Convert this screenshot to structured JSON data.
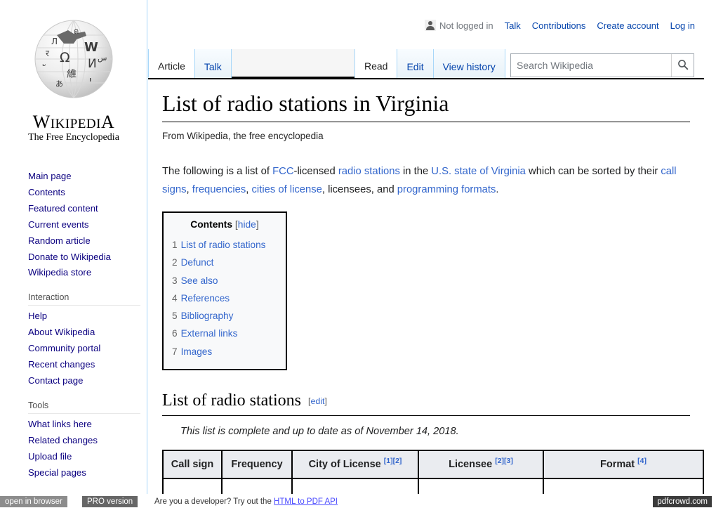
{
  "branding": {
    "wordmark_w": "W",
    "wordmark_rest": "IKIPEDI",
    "wordmark_a": "A",
    "tagline": "The Free Encyclopedia",
    "logo_alt": "wikipedia-globe-logo"
  },
  "user_bar": {
    "user_icon": "user-silhouette-icon",
    "not_logged_in": "Not logged in",
    "links": [
      {
        "label": "Talk"
      },
      {
        "label": "Contributions"
      },
      {
        "label": "Create account"
      },
      {
        "label": "Log in"
      }
    ]
  },
  "tabs": {
    "namespaces": [
      {
        "label": "Article",
        "selected": true
      },
      {
        "label": "Talk",
        "selected": false
      }
    ],
    "views": [
      {
        "label": "Read",
        "selected": true
      },
      {
        "label": "Edit",
        "selected": false
      },
      {
        "label": "View history",
        "selected": false
      }
    ]
  },
  "search": {
    "placeholder": "Search Wikipedia",
    "value": "",
    "icon": "search-icon"
  },
  "sidebar": {
    "portals": [
      {
        "heading": "",
        "items": [
          {
            "label": "Main page"
          },
          {
            "label": "Contents"
          },
          {
            "label": "Featured content"
          },
          {
            "label": "Current events"
          },
          {
            "label": "Random article"
          },
          {
            "label": "Donate to Wikipedia"
          },
          {
            "label": "Wikipedia store"
          }
        ]
      },
      {
        "heading": "Interaction",
        "items": [
          {
            "label": "Help"
          },
          {
            "label": "About Wikipedia"
          },
          {
            "label": "Community portal"
          },
          {
            "label": "Recent changes"
          },
          {
            "label": "Contact page"
          }
        ]
      },
      {
        "heading": "Tools",
        "items": [
          {
            "label": "What links here"
          },
          {
            "label": "Related changes"
          },
          {
            "label": "Upload file"
          },
          {
            "label": "Special pages"
          }
        ]
      }
    ]
  },
  "article": {
    "title": "List of radio stations in Virginia",
    "site_sub": "From Wikipedia, the free encyclopedia",
    "intro": [
      {
        "t": "The following is a list of ",
        "link": false
      },
      {
        "t": "FCC",
        "link": true
      },
      {
        "t": "-licensed ",
        "link": false
      },
      {
        "t": "radio stations",
        "link": true
      },
      {
        "t": " in the ",
        "link": false
      },
      {
        "t": "U.S. state of Virginia",
        "link": true
      },
      {
        "t": " which can be sorted by their ",
        "link": false
      },
      {
        "t": "call signs",
        "link": true
      },
      {
        "t": ", ",
        "link": false
      },
      {
        "t": "frequencies",
        "link": true
      },
      {
        "t": ", ",
        "link": false
      },
      {
        "t": "cities of license",
        "link": true
      },
      {
        "t": ", licensees, and ",
        "link": false
      },
      {
        "t": "programming formats",
        "link": true
      },
      {
        "t": ".",
        "link": false
      }
    ]
  },
  "toc": {
    "title": "Contents",
    "bracket_open": "[",
    "hide_label": "hide",
    "bracket_close": "]",
    "items": [
      {
        "num": "1",
        "label": "List of radio stations"
      },
      {
        "num": "2",
        "label": "Defunct"
      },
      {
        "num": "3",
        "label": "See also"
      },
      {
        "num": "4",
        "label": "References"
      },
      {
        "num": "5",
        "label": "Bibliography"
      },
      {
        "num": "6",
        "label": "External links"
      },
      {
        "num": "7",
        "label": "Images"
      }
    ]
  },
  "section": {
    "heading": "List of radio stations",
    "edit_open": "[",
    "edit_label": "edit",
    "edit_close": "]",
    "note": "This list is complete and up to date as of November 14, 2018."
  },
  "table": {
    "headers": [
      {
        "label": "Call sign",
        "refs": ""
      },
      {
        "label": "Frequency",
        "refs": ""
      },
      {
        "label": "City of License",
        "refs": "[1][2]"
      },
      {
        "label": "Licensee",
        "refs": "[2][3]"
      },
      {
        "label": "Format",
        "refs": "[4]"
      }
    ]
  },
  "footer_bar": {
    "open_in_browser": "open in browser",
    "pro_version": "PRO version",
    "developer_text": "Are you a developer? Try out the ",
    "api_link": "HTML to PDF API",
    "brand": "pdfcrowd.com"
  },
  "colors": {
    "link": "#3366cc",
    "sidebar_link": "#0b0080",
    "tab_border": "#a7d7f9",
    "table_header_bg": "#eaecf0",
    "pro_bg": "#666666",
    "brand_bg": "#3b3b3b"
  }
}
